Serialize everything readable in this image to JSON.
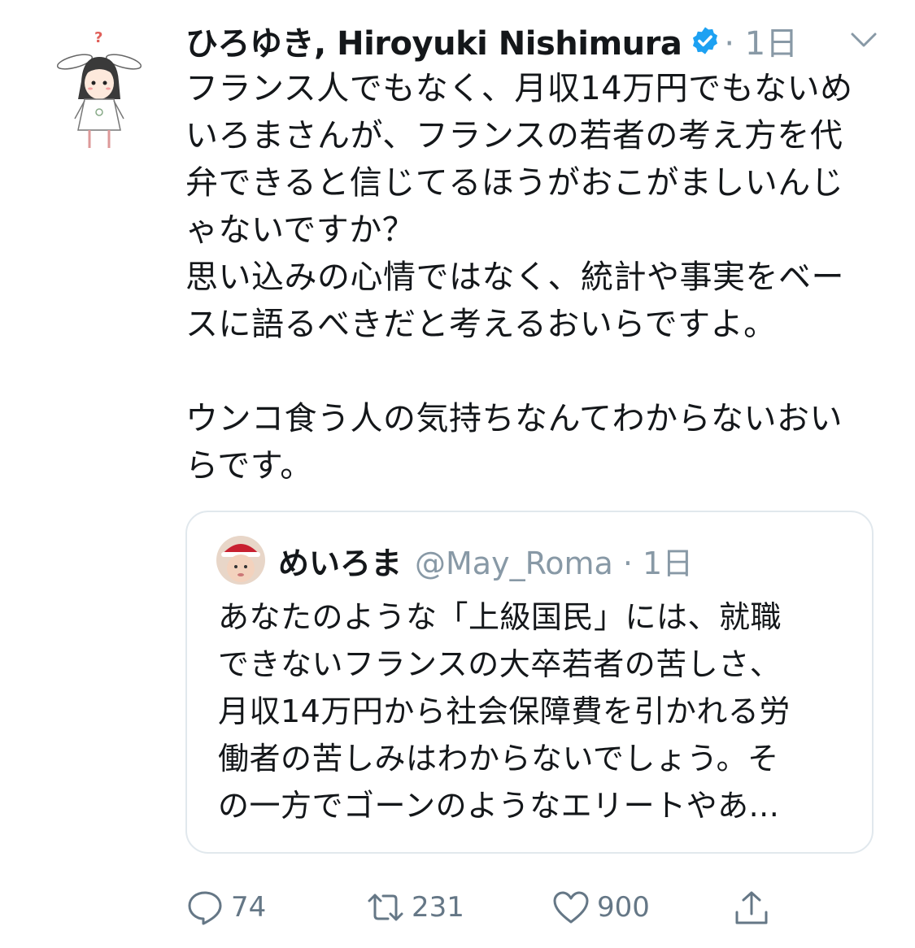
{
  "tweet": {
    "author_name": "ひろゆき, Hiroyuki Nishimura",
    "meta": "· 1日",
    "body_paragraph_1": "フランス人でもなく、月収14万円でもないめ\nいろまさんが、フランスの若者の考え方を代\n弁できると信じてるほうがおこがましいんじ\nゃないですか？\n思い込みの心情ではなく、統計や事実をベー\nスに語るべきだと考えるおいらですよ。",
    "body_paragraph_2": "ウンコ食う人の気持ちなんてわからないおい\nらです。"
  },
  "quoted_tweet": {
    "author_name": "めいろま",
    "handle_meta": "@May_Roma · 1日",
    "text": "あなたのような「上級国民」には、就職\nできないフランスの大卒若者の苦しさ、\n月収14万円から社会保障費を引かれる労\n働者の苦しみはわからないでしょう。そ\nの一方でゴーンのようなエリートやあ..."
  },
  "actions": {
    "reply_count": "74",
    "retweet_count": "231",
    "like_count": "900"
  },
  "icons": {
    "verified": "verified-badge-icon",
    "chevron": "chevron-down-icon",
    "reply": "reply-icon",
    "retweet": "retweet-icon",
    "like": "heart-icon",
    "share": "share-icon"
  },
  "colors": {
    "verified_blue": "#1da1f2",
    "muted_text": "#8899a6",
    "action_gray": "#657786"
  }
}
